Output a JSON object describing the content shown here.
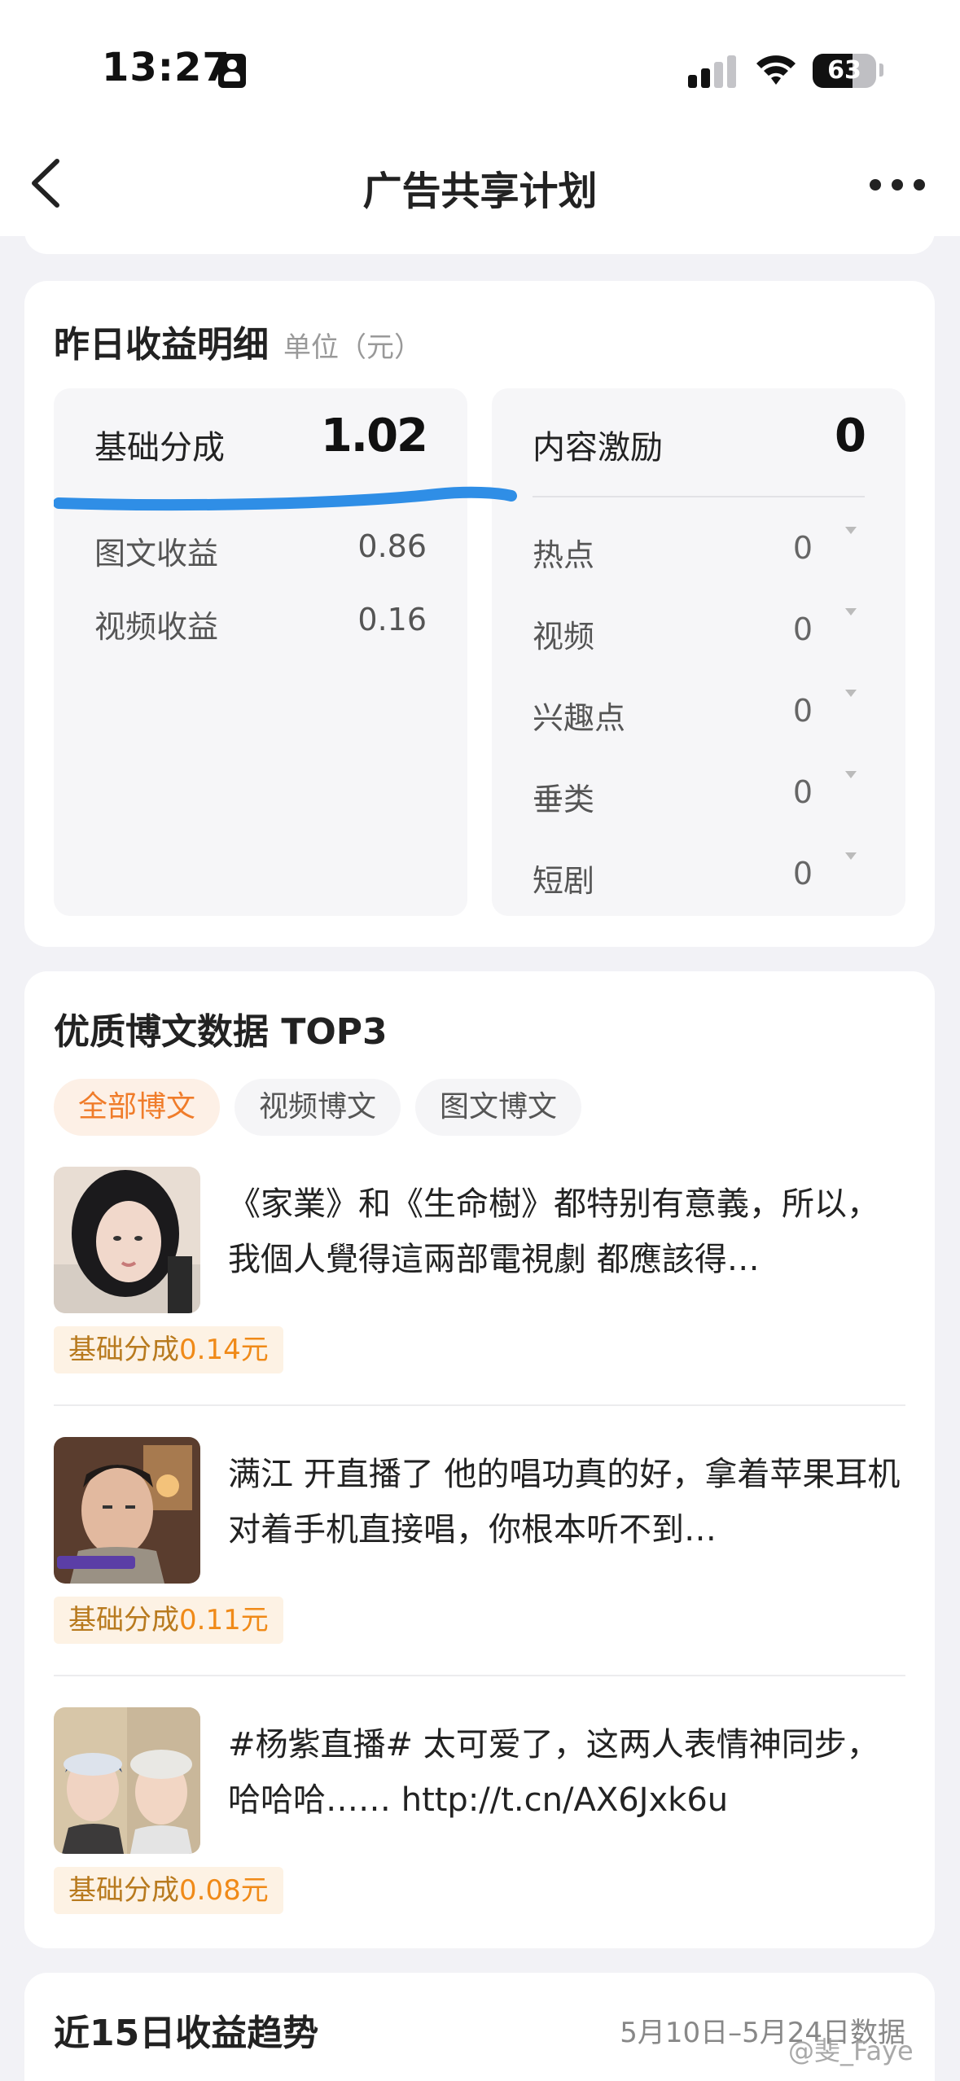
{
  "status": {
    "time": "13:27",
    "battery": "63",
    "battery_level": 0.63
  },
  "nav": {
    "title": "广告共享计划"
  },
  "income": {
    "title": "昨日收益明细",
    "unit": "单位（元）",
    "base": {
      "label": "基础分成",
      "value": "1.02",
      "items": [
        {
          "label": "图文收益",
          "value": "0.86"
        },
        {
          "label": "视频收益",
          "value": "0.16"
        }
      ]
    },
    "content": {
      "label": "内容激励",
      "value": "0",
      "items": [
        {
          "label": "热点",
          "value": "0"
        },
        {
          "label": "视频",
          "value": "0"
        },
        {
          "label": "兴趣点",
          "value": "0"
        },
        {
          "label": "垂类",
          "value": "0"
        },
        {
          "label": "短剧",
          "value": "0"
        }
      ]
    }
  },
  "top_posts": {
    "title": "优质博文数据 TOP3",
    "tabs": [
      "全部博文",
      "视频博文",
      "图文博文"
    ],
    "badge_prefix": "基础分成",
    "posts": [
      {
        "text": "《家業》和《生命樹》都特别有意義，所以，我個人覺得這兩部電視劇 都應該得…",
        "amount": "0.14元"
      },
      {
        "text": "满江 开直播了 他的唱功真的好，拿着苹果耳机 对着手机直接唱，你根本听不到…",
        "amount": "0.11元"
      },
      {
        "text": "#杨紫直播# 太可爱了，这两人表情神同步，哈哈哈…… http://t.cn/AX6Jxk6u",
        "amount": "0.08元"
      }
    ]
  },
  "trend": {
    "title": "近15日收益趋势",
    "date_range": "5月10日–5月24日数据"
  },
  "watermark": "@斐_Faye",
  "colors": {
    "accent": "#f07c2a",
    "highlight_line": "#2f8ee6"
  }
}
